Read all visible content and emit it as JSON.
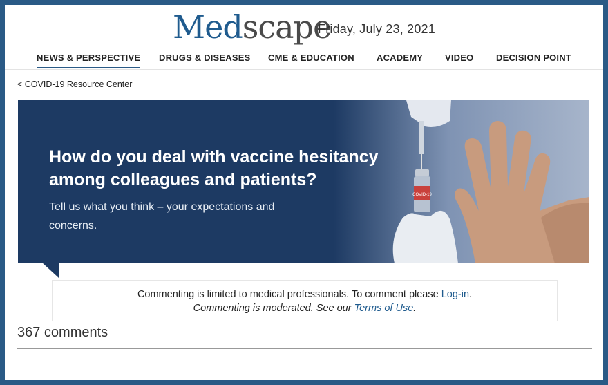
{
  "header": {
    "logo_med": "Med",
    "logo_scape": "scape",
    "date": "Friday, July 23, 2021"
  },
  "nav": {
    "items": [
      {
        "label": "NEWS & PERSPECTIVE",
        "active": true
      },
      {
        "label": "DRUGS & DISEASES",
        "active": false
      },
      {
        "label": "CME & EDUCATION",
        "active": false
      },
      {
        "label": "ACADEMY",
        "active": false
      },
      {
        "label": "VIDEO",
        "active": false
      },
      {
        "label": "DECISION POINT",
        "active": false
      }
    ]
  },
  "breadcrumb": {
    "back_label": "< COVID-19 Resource Center"
  },
  "banner": {
    "title": "How do you deal with vaccine hesitancy among colleagues and patients?",
    "subtitle": "Tell us what you think – your expectations and concerns.",
    "vial_label": "COVID-19"
  },
  "comment_notice": {
    "line1_prefix": "Commenting is limited to medical professionals. To comment please ",
    "login_link": "Log-in",
    "line1_suffix": ".",
    "line2_prefix": "Commenting is moderated. See our ",
    "terms_link": "Terms of Use",
    "line2_suffix": "."
  },
  "comments": {
    "count_label": "367 comments"
  },
  "colors": {
    "border": "#2a5a86",
    "brand_blue": "#1f5b8e",
    "banner_bg": "#1d3a63"
  }
}
